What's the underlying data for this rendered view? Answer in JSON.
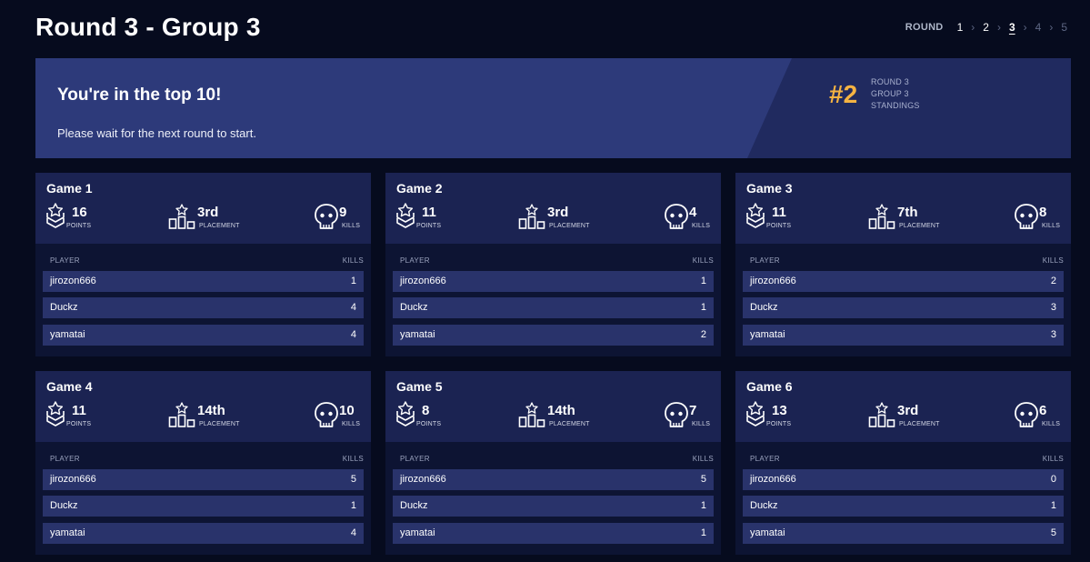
{
  "page_title": "Round 3 - Group 3",
  "round_nav": {
    "label": "ROUND",
    "rounds": [
      "1",
      "2",
      "3",
      "4",
      "5"
    ],
    "active": "3"
  },
  "banner": {
    "headline": "You're in the top 10!",
    "subtext": "Please wait for the next round to start.",
    "rank": "#2",
    "rank_lines": [
      "ROUND 3",
      "GROUP 3",
      "STANDINGS"
    ]
  },
  "labels": {
    "points": "POINTS",
    "placement": "PLACEMENT",
    "kills": "KILLS",
    "col_player": "PLAYER",
    "col_kills": "KILLS"
  },
  "games": [
    {
      "title": "Game 1",
      "points": "16",
      "placement": "3rd",
      "kills": "9",
      "players": [
        {
          "name": "jirozon666",
          "kills": "1"
        },
        {
          "name": "Duckz",
          "kills": "4"
        },
        {
          "name": "yamatai",
          "kills": "4"
        }
      ]
    },
    {
      "title": "Game 2",
      "points": "11",
      "placement": "3rd",
      "kills": "4",
      "players": [
        {
          "name": "jirozon666",
          "kills": "1"
        },
        {
          "name": "Duckz",
          "kills": "1"
        },
        {
          "name": "yamatai",
          "kills": "2"
        }
      ]
    },
    {
      "title": "Game 3",
      "points": "11",
      "placement": "7th",
      "kills": "8",
      "players": [
        {
          "name": "jirozon666",
          "kills": "2"
        },
        {
          "name": "Duckz",
          "kills": "3"
        },
        {
          "name": "yamatai",
          "kills": "3"
        }
      ]
    },
    {
      "title": "Game 4",
      "points": "11",
      "placement": "14th",
      "kills": "10",
      "players": [
        {
          "name": "jirozon666",
          "kills": "5"
        },
        {
          "name": "Duckz",
          "kills": "1"
        },
        {
          "name": "yamatai",
          "kills": "4"
        }
      ]
    },
    {
      "title": "Game 5",
      "points": "8",
      "placement": "14th",
      "kills": "7",
      "players": [
        {
          "name": "jirozon666",
          "kills": "5"
        },
        {
          "name": "Duckz",
          "kills": "1"
        },
        {
          "name": "yamatai",
          "kills": "1"
        }
      ]
    },
    {
      "title": "Game 6",
      "points": "13",
      "placement": "3rd",
      "kills": "6",
      "players": [
        {
          "name": "jirozon666",
          "kills": "0"
        },
        {
          "name": "Duckz",
          "kills": "1"
        },
        {
          "name": "yamatai",
          "kills": "5"
        }
      ]
    }
  ],
  "colors": {
    "background": "#060b1e",
    "banner": "#2d3a7a",
    "rank_accent": "#f5b342",
    "card": "#0d1433",
    "card_header": "#1b2352",
    "row": "#29336b"
  },
  "icons": {
    "points": "chevron-rank-icon",
    "placement": "podium-icon",
    "kills": "skull-icon"
  }
}
